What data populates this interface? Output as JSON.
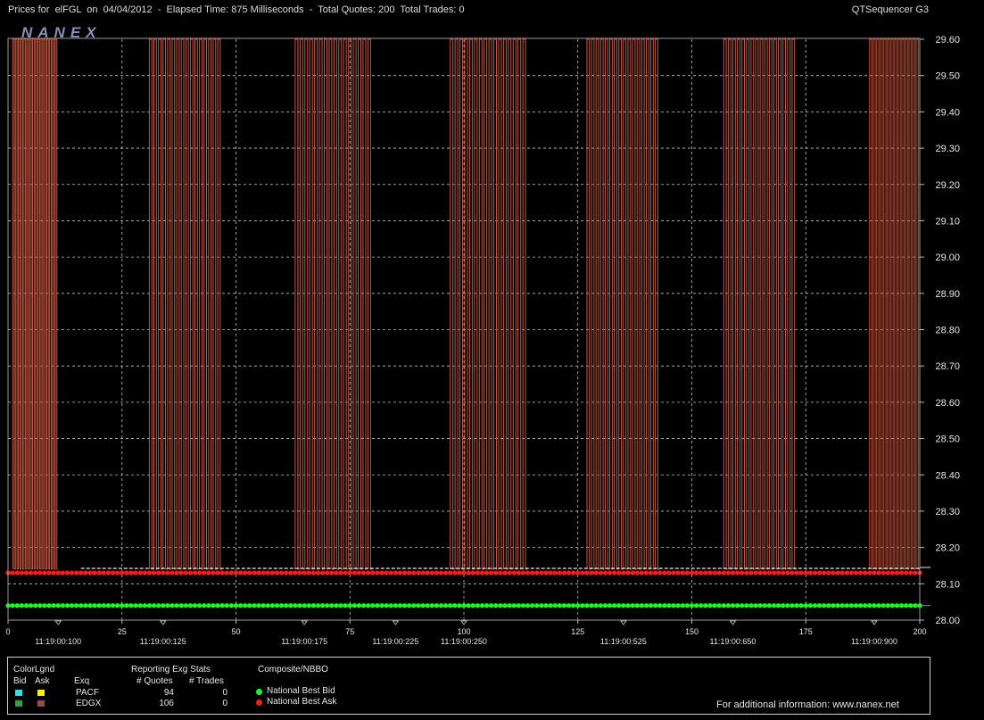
{
  "header": {
    "title": "Prices for  elFGL  on  04/04/2012  -  Elapsed Time: 875 Milliseconds  -  Total Quotes: 200  Total Trades: 0",
    "app_name": "QTSequencer G3",
    "watermark": "NANEX"
  },
  "colors": {
    "background": "#000000",
    "grid": "#bfbfbf",
    "ask_line": "#c8553d",
    "ask_dots": "#ff1a1a",
    "bid_dots": "#1aff1a",
    "bid_cyan": "#33ddee",
    "ask_yellow": "#ffee00",
    "bid_green": "#3c9a4c",
    "ask_brown": "#9a4a4a"
  },
  "chart_data": {
    "type": "line",
    "x_label": "",
    "y_label": "",
    "xlim": [
      0,
      200
    ],
    "ylim": [
      28.0,
      29.6
    ],
    "y_ticks": [
      "29.60",
      "29.50",
      "29.40",
      "29.30",
      "29.20",
      "29.10",
      "29.00",
      "28.90",
      "28.80",
      "28.70",
      "28.60",
      "28.50",
      "28.40",
      "28.30",
      "28.20",
      "28.10",
      "28.00"
    ],
    "x_ticks": [
      "0",
      "25",
      "50",
      "75",
      "100",
      "125",
      "150",
      "175",
      "200"
    ],
    "time_labels": [
      {
        "x": 11,
        "text": "11:19:00:100"
      },
      {
        "x": 34,
        "text": "11:19:00:125"
      },
      {
        "x": 65,
        "text": "11:19:00:175"
      },
      {
        "x": 85,
        "text": "11:19:00:225"
      },
      {
        "x": 100,
        "text": "11:19:00:250"
      },
      {
        "x": 135,
        "text": "11:19:00:525"
      },
      {
        "x": 159,
        "text": "11:19:00:650"
      },
      {
        "x": 190,
        "text": "11:19:00:900"
      }
    ],
    "grid": true,
    "bursts": [
      {
        "start": 1,
        "end": 11,
        "spikes": 16
      },
      {
        "start": 31,
        "end": 47,
        "spikes": 16
      },
      {
        "start": 63,
        "end": 80,
        "spikes": 16
      },
      {
        "start": 97,
        "end": 114,
        "spikes": 16
      },
      {
        "start": 127,
        "end": 143,
        "spikes": 16
      },
      {
        "start": 157,
        "end": 173,
        "spikes": 16
      },
      {
        "start": 189,
        "end": 200,
        "spikes": 14
      }
    ],
    "series": [
      {
        "name": "National Best Bid",
        "values": [
          28.04
        ]
      },
      {
        "name": "National Best Ask",
        "values": [
          28.13
        ]
      }
    ],
    "ask_low": 28.14,
    "ask_high": 29.6
  },
  "legend": {
    "color_legend_title": "ColorLgnd",
    "bid_label": "Bid",
    "ask_label": "Ask",
    "exq_label": "Exq",
    "stats_title": "Reporting Exg Stats",
    "quotes_header": "# Quotes",
    "trades_header": "# Trades",
    "composite_title": "Composite/NBBO",
    "rows": [
      {
        "exchange": "PACF",
        "quotes": "94",
        "trades": "0"
      },
      {
        "exchange": "EDGX",
        "quotes": "106",
        "trades": "0"
      }
    ],
    "nbbo_bid": "National Best Bid",
    "nbbo_ask": "National Best Ask",
    "footer": "For additional information: www.nanex.net"
  }
}
